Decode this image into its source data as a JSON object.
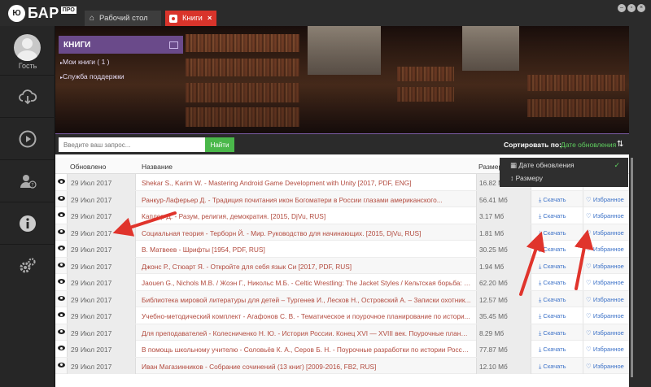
{
  "app": {
    "logo_badge": "Ю",
    "logo_text": "БАР",
    "logo_sup": "ПРО",
    "tabs": [
      {
        "label": "Рабочий стол",
        "icon": "home-icon"
      },
      {
        "label": "Книги",
        "icon": "book-icon",
        "close": "×"
      }
    ],
    "window_buttons": [
      "minimize",
      "restore",
      "close"
    ]
  },
  "sidebar": {
    "user_label": "Гость",
    "icons": [
      "cloud-download-icon",
      "play-icon",
      "user-help-icon",
      "info-icon",
      "settings-gears-icon"
    ]
  },
  "books_panel": {
    "title": "КНИГИ",
    "links": [
      "Мои книги ( 1 )",
      "Служба поддержки"
    ]
  },
  "search": {
    "placeholder": "Введите ваш запрос...",
    "button": "Найти",
    "sort_label": "Сортировать по:",
    "sort_value": "Дате обновления",
    "sort_options": [
      {
        "label": "Дате обновления",
        "icon": "calendar-icon",
        "selected": true
      },
      {
        "label": "Размеру",
        "icon": "sort-size-icon",
        "selected": false
      }
    ],
    "check": "✓"
  },
  "table": {
    "columns": [
      "Обновлено",
      "Название",
      "Размер"
    ],
    "download_label": "Скачать",
    "favorite_label": "Избранное",
    "rows": [
      {
        "date": "29 Июл 2017",
        "title": "Shekar S., Karim W. - Mastering Android Game Development with Unity [2017, PDF, ENG]",
        "size": "16.82 Мб"
      },
      {
        "date": "29 Июл 2017",
        "title": "Ранкур-Лаферьер Д. - Традиция почитания икон Богоматери в России глазами американского...",
        "size": "56.41 Мб"
      },
      {
        "date": "29 Июл 2017",
        "title": "Каплер Д. - Разум, религия, демократия. [2015, DjVu, RUS]",
        "size": "3.17 Мб"
      },
      {
        "date": "29 Июл 2017",
        "title": "Социальная теория - Терборн Й. - Мир. Руководство для начинающих. [2015, DjVu, RUS]",
        "size": "1.81 Мб"
      },
      {
        "date": "29 Июл 2017",
        "title": "В. Матвеев - Шрифты [1954, PDF, RUS]",
        "size": "30.25 Мб"
      },
      {
        "date": "29 Июл 2017",
        "title": "Джонс Р., Стюарт Я. - Откройте для себя язык Си [2017, PDF, RUS]",
        "size": "1.94 Мб"
      },
      {
        "date": "29 Июл 2017",
        "title": "Jaouen G., Nichols M.B. / Жоэн Г., Никольс М.Б. - Celtic Wrestling: The Jacket Styles / Кельтская борьба: сти...",
        "size": "62.20 Мб"
      },
      {
        "date": "29 Июл 2017",
        "title": "Библиотека мировой литературы для детей – Тургенев И., Лесков Н., Островский А. – Записки охотник...",
        "size": "12.57 Мб"
      },
      {
        "date": "29 Июл 2017",
        "title": "Учебно-методический комплект - Агафонов С. В. - Тематическое и поурочное планирование по истори...",
        "size": "35.45 Мб"
      },
      {
        "date": "29 Июл 2017",
        "title": "Для преподавателей - Колесниченко Н. Ю. - История России. Конец XVI — XVIII век. Поурочные планы....",
        "size": "8.29 Мб"
      },
      {
        "date": "29 Июл 2017",
        "title": "В помощь школьному учителю - Соловьёв К. А., Серов Б. Н. - Поурочные разработки по истории Россия...",
        "size": "77.87 Мб"
      },
      {
        "date": "29 Июл 2017",
        "title": "Иван Магазинников - Собрание сочинений (13 книг) [2009-2016, FB2, RUS]",
        "size": "12.10 Мб"
      }
    ]
  },
  "colors": {
    "accent_red": "#d9342b",
    "purple": "#6a4a8a",
    "green": "#4ab84a",
    "link": "#3a70c7",
    "title_text": "#b24a3e",
    "annotation_arrow": "#e0342c"
  }
}
